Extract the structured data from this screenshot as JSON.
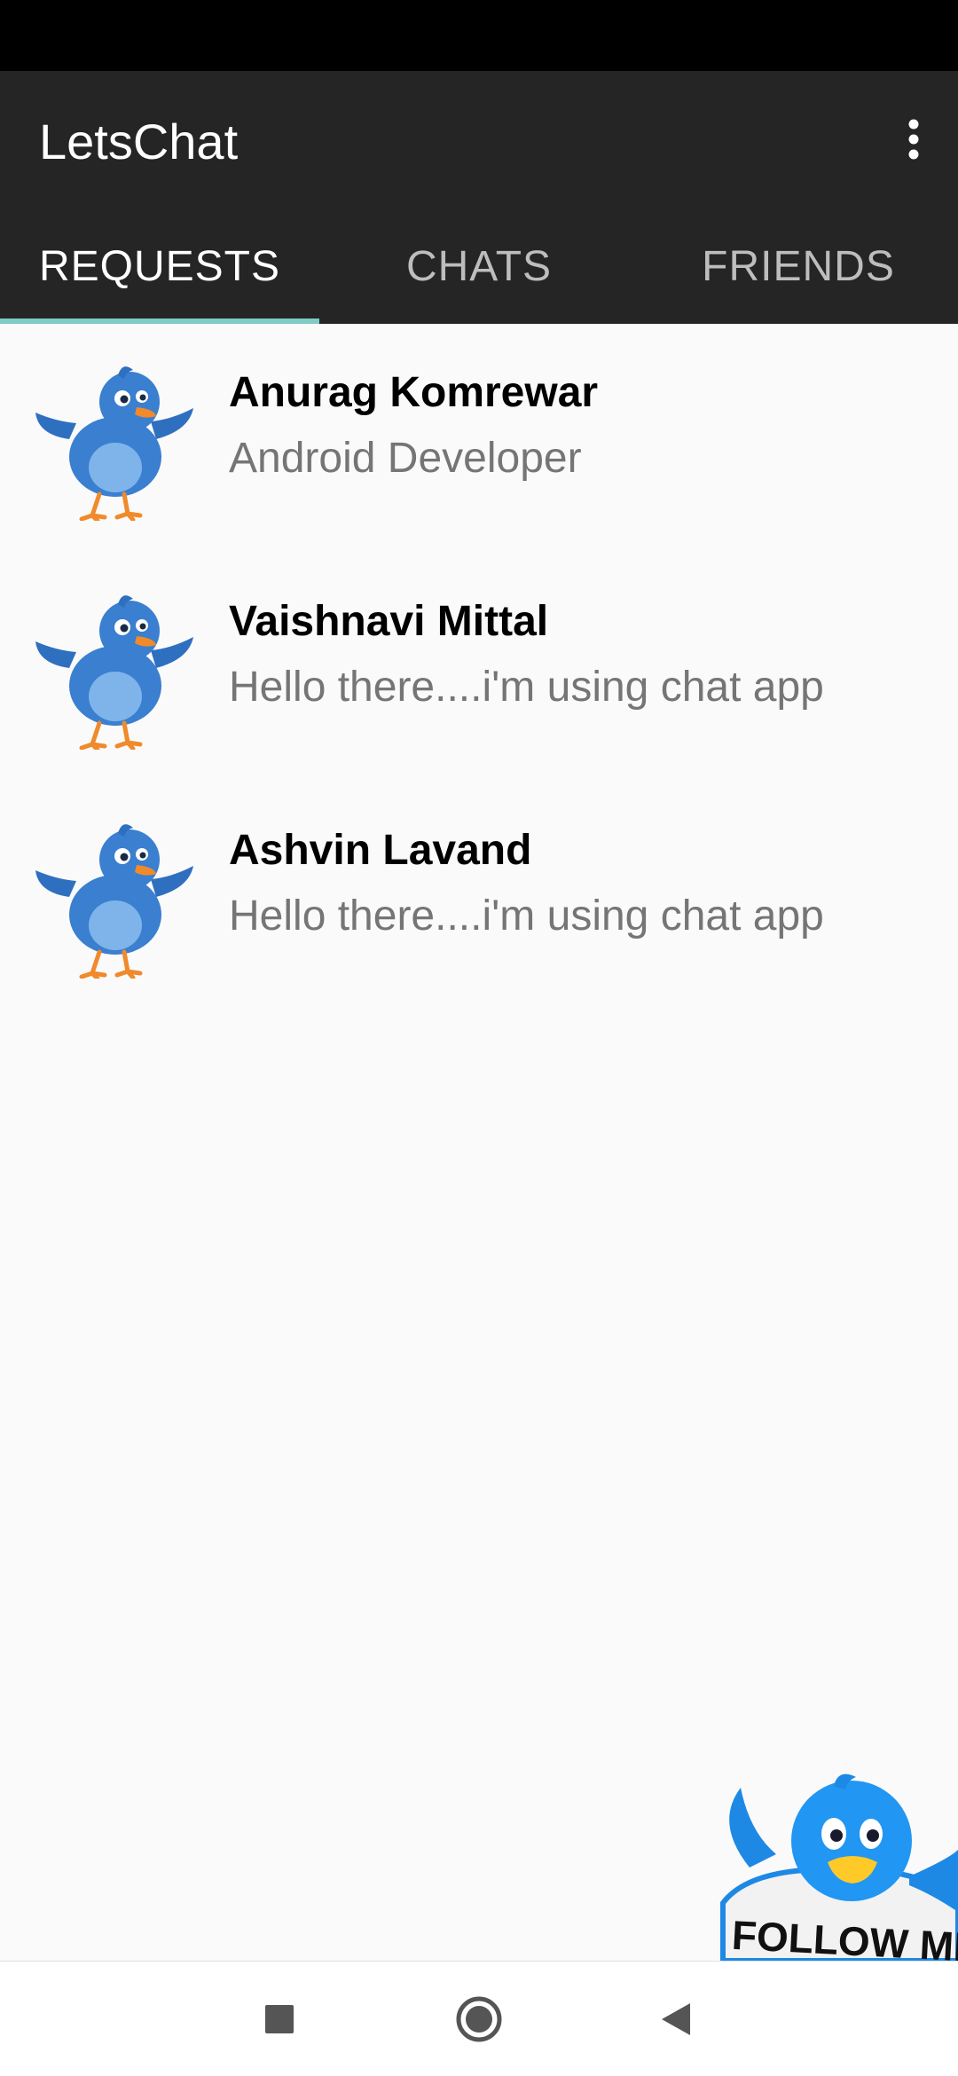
{
  "app": {
    "title": "LetsChat"
  },
  "tabs": [
    {
      "label": "REQUESTS",
      "active": true
    },
    {
      "label": "CHATS",
      "active": false
    },
    {
      "label": "FRIENDS",
      "active": false
    }
  ],
  "requests": [
    {
      "name": "Anurag Komrewar",
      "status": "Android Developer",
      "avatar_icon": "bird-avatar-icon"
    },
    {
      "name": "Vaishnavi Mittal",
      "status": "Hello there....i'm using chat app",
      "avatar_icon": "bird-avatar-icon"
    },
    {
      "name": "Ashvin Lavand",
      "status": "Hello there....i'm using chat app",
      "avatar_icon": "bird-avatar-icon"
    }
  ],
  "floating_badge": {
    "text": "FOLLOW ME"
  },
  "icons": {
    "overflow": "more-vert-icon",
    "nav_recents": "square-icon",
    "nav_home": "circle-icon",
    "nav_back": "triangle-back-icon"
  },
  "colors": {
    "app_bar": "#252525",
    "status_bar": "#000000",
    "tab_indicator": "#80cbc4",
    "tab_inactive": "#bdbdbd",
    "secondary_text": "#757575",
    "background": "#fafafa"
  }
}
